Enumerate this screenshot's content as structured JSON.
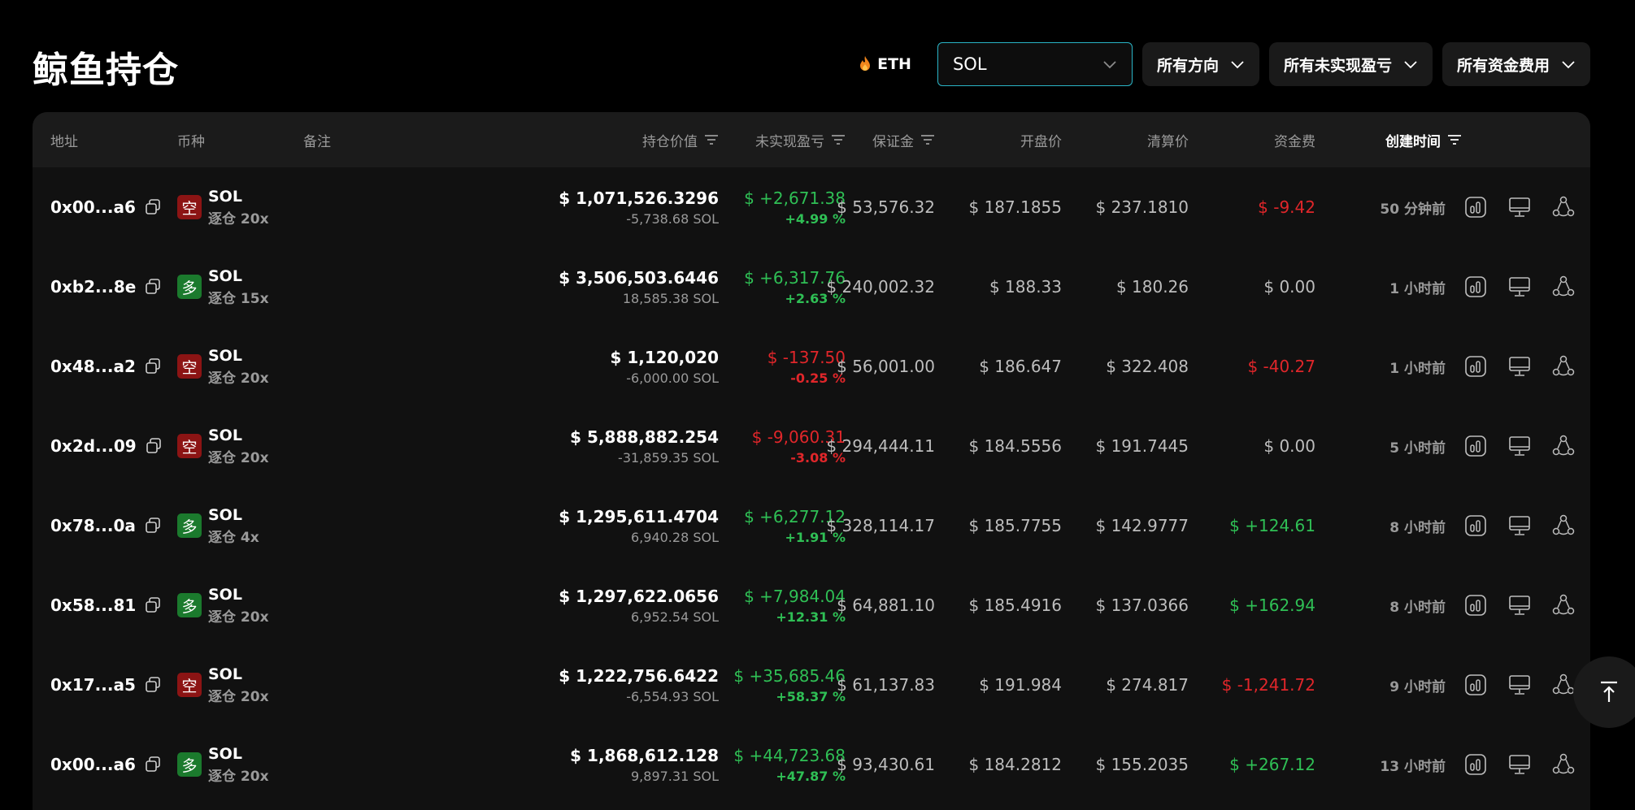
{
  "page": {
    "title": "鲸鱼持仓"
  },
  "filters": {
    "eth_label": "ETH",
    "coin_selected": "SOL",
    "direction": "所有方向",
    "pnl": "所有未实现盈亏",
    "funding": "所有资金费用"
  },
  "colors": {
    "green": "#2fbf55",
    "red": "#e0262a",
    "accent": "#2ab4c6"
  },
  "table": {
    "headers": {
      "address": "地址",
      "coin": "币种",
      "note": "备注",
      "position_value": "持仓价值",
      "unrealized_pnl": "未实现盈亏",
      "margin": "保证金",
      "entry_price": "开盘价",
      "liq_price": "清算价",
      "funding_fee": "资金费",
      "created": "创建时间"
    },
    "rows": [
      {
        "address": "0x00...a6",
        "side": "空",
        "coin": "SOL",
        "leverage": "逐仓 20x",
        "value": "$ 1,071,526.3296",
        "size": "-5,738.68 SOL",
        "pnl": "$ +2,671.38",
        "pnl_pct": "+4.99 %",
        "pnl_color": "#2fbf55",
        "margin": "$ 53,576.32",
        "entry": "$ 187.1855",
        "liq": "$ 237.1810",
        "funding": "$ -9.42",
        "funding_color": "#e0262a",
        "time": "50 分钟前"
      },
      {
        "address": "0xb2...8e",
        "side": "多",
        "coin": "SOL",
        "leverage": "逐仓 15x",
        "value": "$ 3,506,503.6446",
        "size": "18,585.38 SOL",
        "pnl": "$ +6,317.76",
        "pnl_pct": "+2.63 %",
        "pnl_color": "#2fbf55",
        "margin": "$ 240,002.32",
        "entry": "$ 188.33",
        "liq": "$ 180.26",
        "funding": "$ 0.00",
        "funding_color": "#bdbdbd",
        "time": "1 小时前"
      },
      {
        "address": "0x48...a2",
        "side": "空",
        "coin": "SOL",
        "leverage": "逐仓 20x",
        "value": "$ 1,120,020",
        "size": "-6,000.00 SOL",
        "pnl": "$ -137.50",
        "pnl_pct": "-0.25 %",
        "pnl_color": "#e0262a",
        "margin": "$ 56,001.00",
        "entry": "$ 186.647",
        "liq": "$ 322.408",
        "funding": "$ -40.27",
        "funding_color": "#e0262a",
        "time": "1 小时前"
      },
      {
        "address": "0x2d...09",
        "side": "空",
        "coin": "SOL",
        "leverage": "逐仓 20x",
        "value": "$ 5,888,882.254",
        "size": "-31,859.35 SOL",
        "pnl": "$ -9,060.31",
        "pnl_pct": "-3.08 %",
        "pnl_color": "#e0262a",
        "margin": "$ 294,444.11",
        "entry": "$ 184.5556",
        "liq": "$ 191.7445",
        "funding": "$ 0.00",
        "funding_color": "#bdbdbd",
        "time": "5 小时前"
      },
      {
        "address": "0x78...0a",
        "side": "多",
        "coin": "SOL",
        "leverage": "逐仓 4x",
        "value": "$ 1,295,611.4704",
        "size": "6,940.28 SOL",
        "pnl": "$ +6,277.12",
        "pnl_pct": "+1.91 %",
        "pnl_color": "#2fbf55",
        "margin": "$ 328,114.17",
        "entry": "$ 185.7755",
        "liq": "$ 142.9777",
        "funding": "$ +124.61",
        "funding_color": "#2fbf55",
        "time": "8 小时前"
      },
      {
        "address": "0x58...81",
        "side": "多",
        "coin": "SOL",
        "leverage": "逐仓 20x",
        "value": "$ 1,297,622.0656",
        "size": "6,952.54 SOL",
        "pnl": "$ +7,984.04",
        "pnl_pct": "+12.31 %",
        "pnl_color": "#2fbf55",
        "margin": "$ 64,881.10",
        "entry": "$ 185.4916",
        "liq": "$ 137.0366",
        "funding": "$ +162.94",
        "funding_color": "#2fbf55",
        "time": "8 小时前"
      },
      {
        "address": "0x17...a5",
        "side": "空",
        "coin": "SOL",
        "leverage": "逐仓 20x",
        "value": "$ 1,222,756.6422",
        "size": "-6,554.93 SOL",
        "pnl": "$ +35,685.46",
        "pnl_pct": "+58.37 %",
        "pnl_color": "#2fbf55",
        "margin": "$ 61,137.83",
        "entry": "$ 191.984",
        "liq": "$ 274.817",
        "funding": "$ -1,241.72",
        "funding_color": "#e0262a",
        "time": "9 小时前"
      },
      {
        "address": "0x00...a6",
        "side": "多",
        "coin": "SOL",
        "leverage": "逐仓 20x",
        "value": "$ 1,868,612.128",
        "size": "9,897.31 SOL",
        "pnl": "$ +44,723.68",
        "pnl_pct": "+47.87 %",
        "pnl_color": "#2fbf55",
        "margin": "$ 93,430.61",
        "entry": "$ 184.2812",
        "liq": "$ 155.2035",
        "funding": "$ +267.12",
        "funding_color": "#2fbf55",
        "time": "13 小时前"
      }
    ]
  }
}
